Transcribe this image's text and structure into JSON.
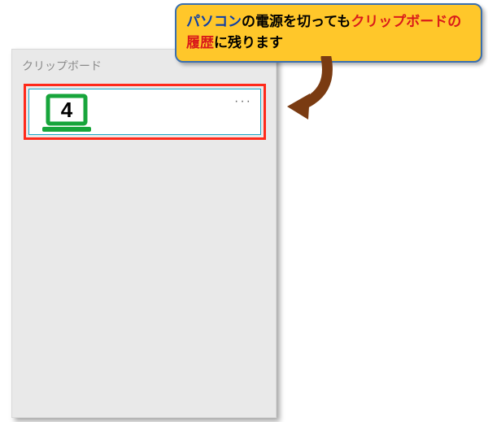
{
  "panel": {
    "title": "クリップボード",
    "item": {
      "number": "4",
      "menu_glyph": "···"
    }
  },
  "callout": {
    "seg1_blue": "パソコン",
    "seg2_black": "の電源を切っても",
    "seg3_red": "クリップボードの履歴",
    "seg4_black": "に残ります"
  }
}
